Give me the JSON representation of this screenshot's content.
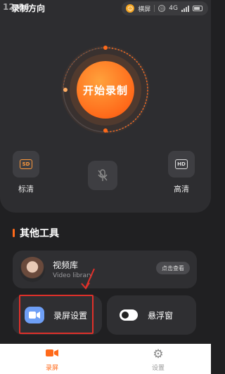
{
  "status_bar": {
    "time": "12:06",
    "title_overlay": "录制方向",
    "orientation_label": "横屏",
    "sim_label": "4G"
  },
  "recorder": {
    "start_label": "开始录制",
    "quality_sd_badge": "SD",
    "quality_sd_label": "标清",
    "quality_hd_badge": "HD",
    "quality_hd_label": "高清"
  },
  "tools": {
    "section_title": "其他工具",
    "video_library": {
      "title": "视频库",
      "subtitle": "Video library",
      "view_label": "点击查看"
    },
    "record_settings_label": "录屏设置",
    "floating_window_label": "悬浮窗"
  },
  "bottom_nav": {
    "record_label": "录屏",
    "settings_label": "设置"
  },
  "colors": {
    "accent": "#ff6a1a",
    "highlight": "#e0302a",
    "settings_icon": "#6e9ff6"
  }
}
